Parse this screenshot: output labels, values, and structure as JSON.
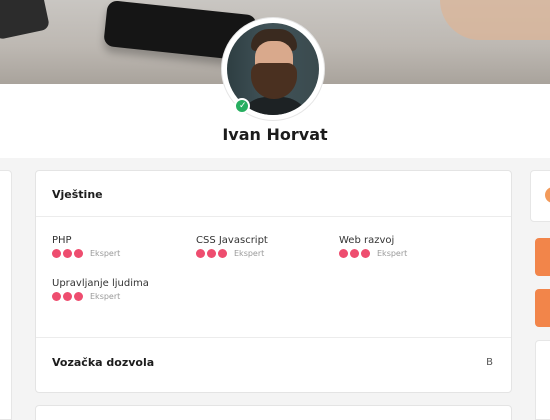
{
  "profile": {
    "name": "Ivan Horvat",
    "verified": true
  },
  "skills_card": {
    "title": "Vještine",
    "skills": [
      {
        "name": "PHP",
        "level": "Ekspert",
        "rating": 3
      },
      {
        "name": "CSS Javascript",
        "level": "Ekspert",
        "rating": 3
      },
      {
        "name": "Web razvoj",
        "level": "Ekspert",
        "rating": 3
      },
      {
        "name": "Upravljanje ljudima",
        "level": "Ekspert",
        "rating": 3
      }
    ],
    "license_label": "Vozačka dozvola",
    "license_value": "B"
  },
  "colors": {
    "rating_dot": "#ee4d6f",
    "accent_orange": "#f2854a",
    "verified_green": "#27ae60"
  },
  "icons": {
    "verified": "check-icon"
  }
}
